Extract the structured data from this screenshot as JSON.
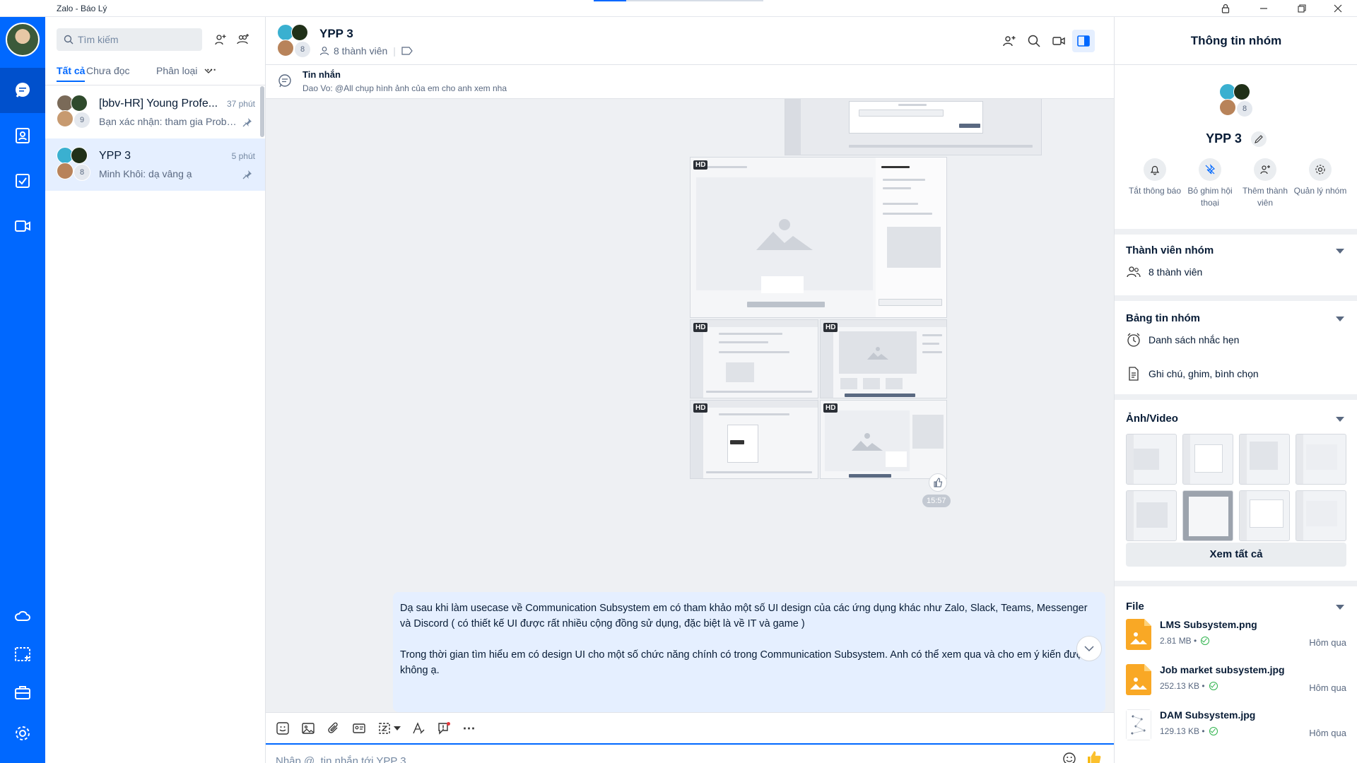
{
  "window": {
    "title": "Zalo - Báo Lý"
  },
  "colors": {
    "brand": "#0068ff",
    "bubble": "#e5efff",
    "bg": "#eef0f3"
  },
  "rail": {
    "items": [
      {
        "name": "messages",
        "icon": "chat-bubble-icon",
        "active": true
      },
      {
        "name": "contacts",
        "icon": "contact-card-icon"
      },
      {
        "name": "todo",
        "icon": "checkbox-icon"
      },
      {
        "name": "video",
        "icon": "video-icon"
      }
    ],
    "bottom": [
      {
        "name": "cloud",
        "icon": "cloud-icon"
      },
      {
        "name": "capture",
        "icon": "screen-capture-icon"
      },
      {
        "name": "toolbox",
        "icon": "briefcase-icon"
      },
      {
        "name": "settings",
        "icon": "gear-icon"
      }
    ]
  },
  "convlist": {
    "search_placeholder": "Tìm kiếm",
    "tabs": {
      "all": "Tất cả",
      "unread": "Chưa đọc",
      "classify": "Phân loại"
    },
    "items": [
      {
        "name": "[bbv-HR] Young Profe...",
        "time": "37 phút",
        "msg": "Bạn xác nhận: tham gia Probl...",
        "count": "9"
      },
      {
        "name": "YPP 3",
        "time": "5 phút",
        "msg": "Minh Khôi: dạ vâng ạ",
        "count": "8"
      }
    ]
  },
  "chat": {
    "title": "YPP 3",
    "members": "8 thành viên",
    "avatar_count": "8",
    "pinned_title": "Tin nhắn",
    "pinned_text": "Dao Vo: @All chụp hình ảnh của em cho anh xem nha",
    "hd": "HD",
    "timestamp": "15:57",
    "message_p1": "Dạ sau khi làm usecase về Communication Subsystem em có tham khảo một số UI design của các ứng dụng khác như Zalo, Slack, Teams, Messenger và Discord ( có thiết kế UI được rất nhiều cộng đồng sử dụng, đặc biệt là về IT và game )",
    "message_p2": "Trong thời gian tìm hiểu em có design UI cho một số chức năng chính có trong Communication Subsystem. Anh có thể xem qua và cho em ý kiến được không ạ.",
    "composer_placeholder": "Nhập @, tin nhắn tới YPP 3"
  },
  "panel": {
    "title": "Thông tin nhóm",
    "group_name": "YPP 3",
    "avatar_count": "8",
    "actions": [
      {
        "label": "Tắt thông báo",
        "icon": "bell-icon"
      },
      {
        "label": "Bỏ ghim hội thoại",
        "icon": "unpin-icon"
      },
      {
        "label": "Thêm thành viên",
        "icon": "add-member-icon"
      },
      {
        "label": "Quản lý nhóm",
        "icon": "gear-icon"
      }
    ],
    "members_title": "Thành viên nhóm",
    "members_count": "8 thành viên",
    "board_title": "Bảng tin nhóm",
    "reminders": "Danh sách nhắc hẹn",
    "notes": "Ghi chú, ghim, bình chọn",
    "media_title": "Ảnh/Video",
    "see_all": "Xem tất cả",
    "file_title": "File",
    "files": [
      {
        "name": "LMS Subsystem.png",
        "size": "2.81 MB",
        "date": "Hôm qua"
      },
      {
        "name": "Job market subsystem.jpg",
        "size": "252.13 KB",
        "date": "Hôm qua"
      },
      {
        "name": "DAM Subsystem.jpg",
        "size": "129.13 KB",
        "date": "Hôm qua"
      }
    ]
  }
}
